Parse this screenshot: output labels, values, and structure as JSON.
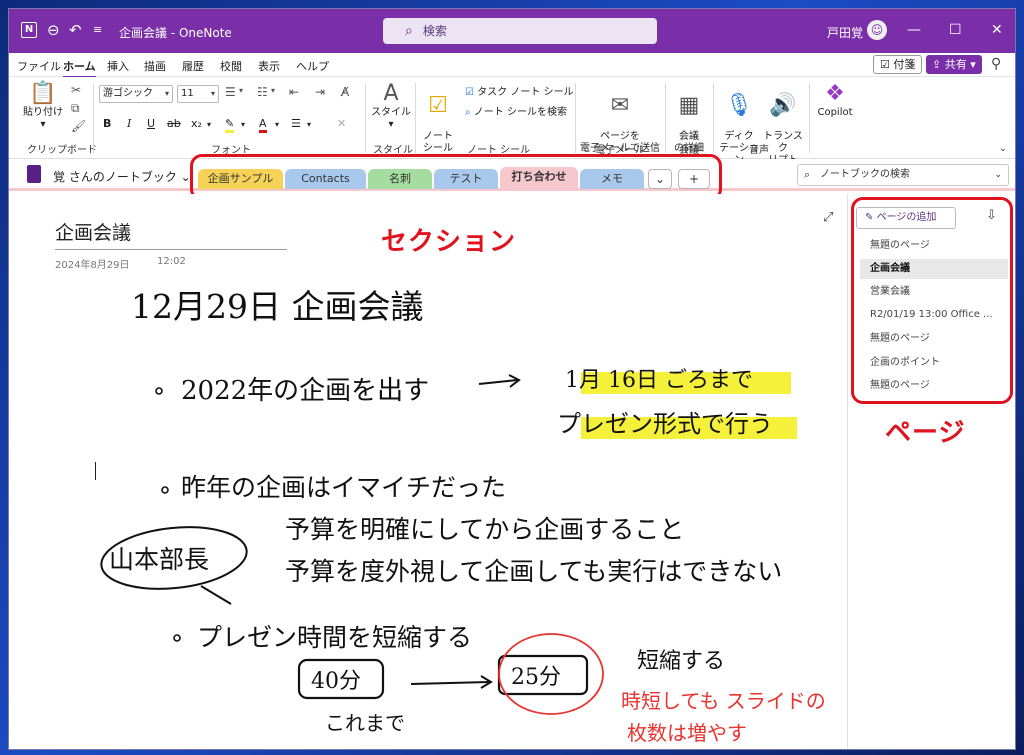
{
  "window": {
    "title": "企画会議  -  OneNote",
    "search_placeholder": "検索",
    "user_name": "戸田覚",
    "controls": {
      "minimize": "—",
      "maximize": "☐",
      "close": "✕"
    }
  },
  "menu": {
    "items": [
      "ファイル",
      "ホーム",
      "挿入",
      "描画",
      "履歴",
      "校閲",
      "表示",
      "ヘルプ"
    ],
    "active": "ホーム",
    "sticky_label": "付箋",
    "share_label": "共有"
  },
  "ribbon": {
    "clipboard": {
      "paste_label": "貼り付け",
      "group": "クリップボード"
    },
    "font": {
      "font_name": "游ゴシック",
      "font_size": "11",
      "group": "フォント",
      "bold": "B",
      "italic": "I",
      "underline": "U",
      "strike": "ab"
    },
    "style": {
      "label": "スタイル",
      "group": "スタイル"
    },
    "tags": {
      "note_tag": "ノート\nシール",
      "todo_tag": "タスク ノート シール",
      "find_tags": "ノート シールを検索",
      "group": "ノート シール"
    },
    "email": {
      "send_label": "ページを\n電子メールで送信",
      "group": "電子メール"
    },
    "meeting": {
      "label": "会議\nの詳細",
      "group": "会議"
    },
    "voice": {
      "dictate": "ディク\nテーション",
      "transcribe": "トランスク\nリプト",
      "group": "音声"
    },
    "copilot": {
      "label": "Copilot"
    }
  },
  "notebook": {
    "name": "覚 さんのノートブック",
    "search_placeholder": "ノートブックの検索"
  },
  "sections": [
    {
      "label": "企画サンプル",
      "color": "#f6d256",
      "active": false
    },
    {
      "label": "Contacts",
      "color": "#a8c8ec",
      "active": false
    },
    {
      "label": "名刺",
      "color": "#a5dca0",
      "active": false
    },
    {
      "label": "テスト",
      "color": "#a8c8ec",
      "active": false
    },
    {
      "label": "打ち合わせ",
      "color": "#f6c7cc",
      "active": true
    },
    {
      "label": "メモ",
      "color": "#a8c8ec",
      "active": false
    }
  ],
  "page": {
    "title": "企画会議",
    "date": "2024年8月29日",
    "time": "12:02"
  },
  "annotations": {
    "section_callout": "セクション",
    "page_callout": "ページ"
  },
  "handwriting": {
    "heading": "12月29日 企画会議",
    "line1": "2022年の企画を出す",
    "line1_right": "1月 16日 ごろまで",
    "line1_right2": "プレゼン形式で行う",
    "line2": "昨年の企画はイマイチだった",
    "circle_name": "山本部長",
    "line3": "予算を明確にしてから企画すること",
    "line4": "予算を度外視して企画しても実行はできない",
    "line5": "プレゼン時間を短縮する",
    "box_before": "40分",
    "box_after": "25分",
    "note_before": "これまで",
    "note_short": "短縮する",
    "red_note1": "時短しても スライドの",
    "red_note2": "枚数は増やす"
  },
  "pages_pane": {
    "add_label": "ページの追加",
    "items": [
      {
        "label": "無題のページ",
        "active": false
      },
      {
        "label": "企画会議",
        "active": true
      },
      {
        "label": "営業会議",
        "active": false
      },
      {
        "label": "R2/01/19 13:00 Office ...",
        "active": false
      },
      {
        "label": "無題のページ",
        "active": false
      },
      {
        "label": "企画のポイント",
        "active": false
      },
      {
        "label": "無題のページ",
        "active": false
      }
    ]
  },
  "colors": {
    "accent": "#7a2ea8",
    "callout": "#e0121e",
    "highlight": "#f5f03a",
    "red_ink": "#e8332e"
  }
}
